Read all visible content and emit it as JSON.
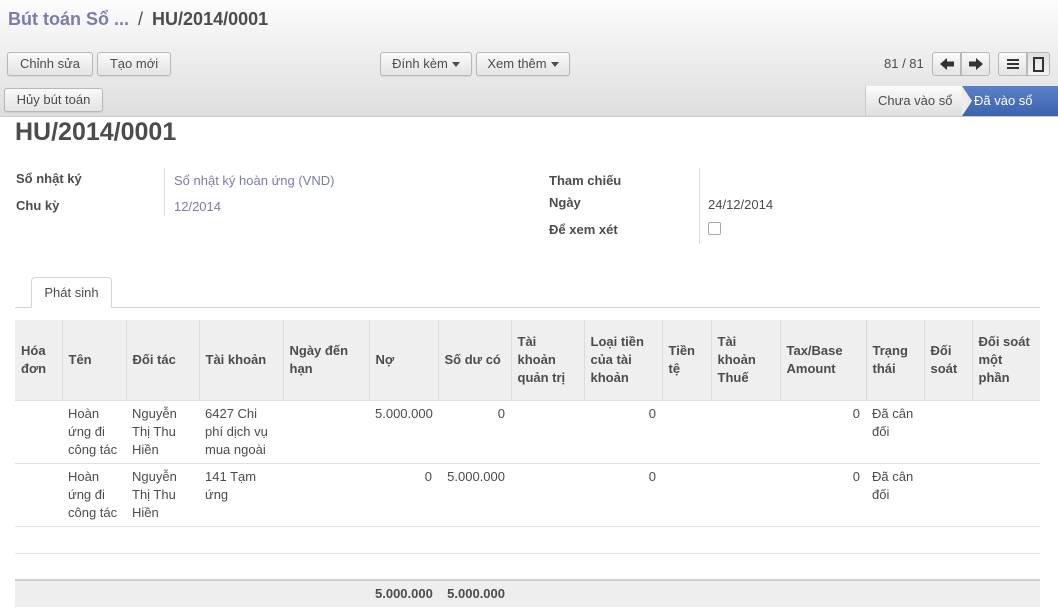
{
  "breadcrumb": {
    "parent": "Bút toán Sổ ...",
    "separator": "/",
    "current": "HU/2014/0001"
  },
  "toolbar": {
    "edit": "Chỉnh sửa",
    "create": "Tạo mới",
    "attach": "Đính kèm",
    "more": "Xem thêm"
  },
  "pager": {
    "value": "81 / 81"
  },
  "actions": {
    "cancel_entry": "Hủy bút toán"
  },
  "status": {
    "stages": [
      "Chưa vào sổ",
      "Đã vào sổ"
    ],
    "active": "Đã vào sổ",
    "active_color": "#4a6fb5"
  },
  "form": {
    "title": "HU/2014/0001",
    "journal_label": "Sổ nhật ký",
    "journal_value": "Sổ nhật ký hoàn ứng (VND)",
    "period_label": "Chu kỳ",
    "period_value": "12/2014",
    "reference_label": "Tham chiếu",
    "reference_value": "",
    "date_label": "Ngày",
    "date_value": "24/12/2014",
    "review_label": "Để xem xét",
    "review_checked": false
  },
  "tabs": [
    "Phát sinh"
  ],
  "table": {
    "headers": [
      "Hóa đơn",
      "Tên",
      "Đối tác",
      "Tài khoản",
      "Ngày đến hạn",
      "Nợ",
      "Số dư có",
      "Tài khoản quản trị",
      "Loại tiền của tài khoản",
      "Tiền tệ",
      "Tài khoản Thuế",
      "Tax/Base Amount",
      "Trạng thái",
      "Đối soát",
      "Đối soát một phần"
    ],
    "rows": [
      [
        "",
        "Hoàn ứng đi công tác",
        "Nguyễn Thị Thu Hiền",
        "6427 Chi phí dịch vụ mua ngoài",
        "",
        "5.000.000",
        "0",
        "",
        "0",
        "",
        "",
        "0",
        "Đã cân đối",
        "",
        ""
      ],
      [
        "",
        "Hoàn ứng đi công tác",
        "Nguyễn Thị Thu Hiền",
        "141 Tạm ứng",
        "",
        "0",
        "5.000.000",
        "",
        "0",
        "",
        "",
        "0",
        "Đã cân đối",
        "",
        ""
      ]
    ],
    "totals": {
      "debit": "5.000.000",
      "credit": "5.000.000"
    }
  },
  "colors": {
    "link": "#7c7bad",
    "accent": "#4a6fb5"
  }
}
